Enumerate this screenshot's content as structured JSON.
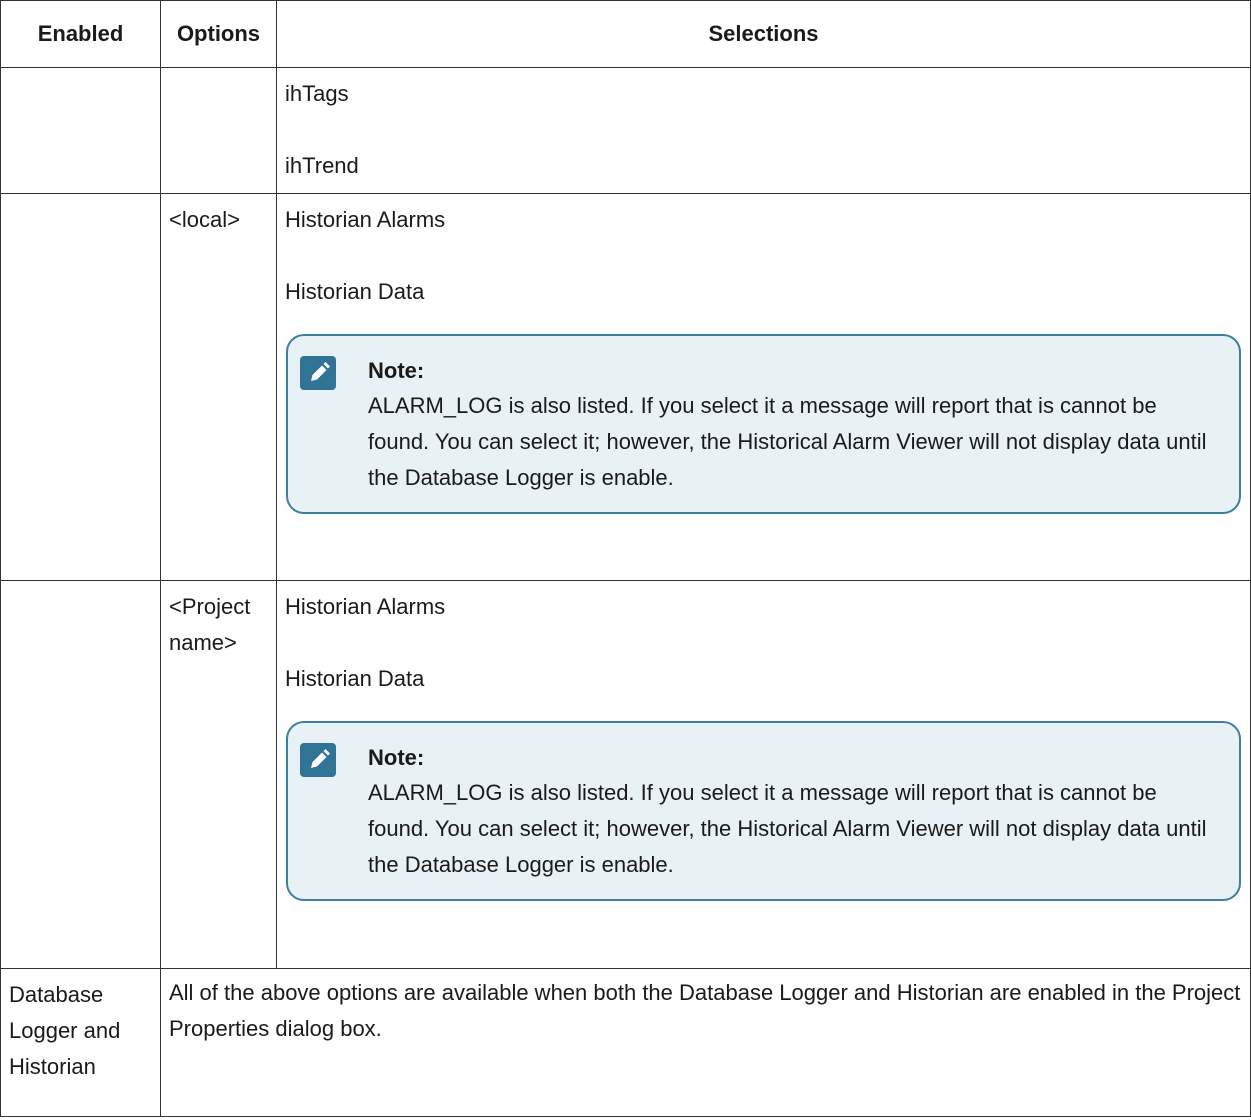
{
  "table": {
    "headers": {
      "enabled": "Enabled",
      "options": "Options",
      "selections": "Selections"
    },
    "rows": [
      {
        "enabled": "",
        "option": "",
        "selections": [
          "ihTags",
          "ihTrend"
        ]
      },
      {
        "enabled": "",
        "option": "<local>",
        "selections": [
          "Historian Alarms",
          "Historian Data"
        ],
        "note": {
          "title": "Note:",
          "text": "ALARM_LOG is also listed. If you select it a message will report that is cannot be found. You can select it; however, the Historical Alarm Viewer will not display data until the Database Logger is enable."
        }
      },
      {
        "enabled": "",
        "option": "<Project name>",
        "selections": [
          "Historian Alarms",
          "Historian Data"
        ],
        "note": {
          "title": "Note:",
          "text": "ALARM_LOG is also listed. If you select it a message will report that is cannot be found. You can select it; however, the Historical Alarm Viewer will not display data until the Database Logger is enable."
        }
      },
      {
        "enabled": "Database Logger and Historian",
        "text": "All of the above options are available when both the Database Logger and Historian are enabled in the Project Properties dialog box."
      }
    ]
  },
  "icons": {
    "note_icon": "pencil-on-clipboard-icon"
  },
  "colors": {
    "note_border": "#3e7f9e",
    "note_background": "#e8f1f5",
    "note_icon": "#2f7395"
  }
}
